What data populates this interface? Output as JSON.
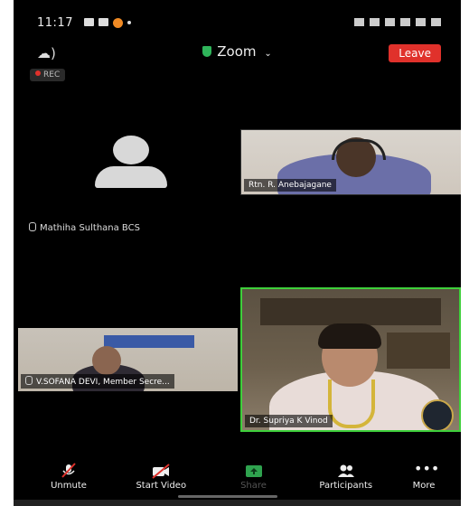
{
  "status_bar": {
    "time": "11:17"
  },
  "header": {
    "meeting_title": "Zoom",
    "leave_label": "Leave",
    "rec_label": "REC"
  },
  "participants": [
    {
      "name": "Rtn. R. Anebajagane"
    },
    {
      "name": "Mathiha Sulthana BCS"
    },
    {
      "name": "V.SOFANA DEVI, Member Secre..."
    },
    {
      "name": "Dr. Supriya K Vinod"
    }
  ],
  "toolbar": {
    "unmute": "Unmute",
    "start_video": "Start Video",
    "share": "Share",
    "participants": "Participants",
    "more": "More"
  },
  "colors": {
    "leave_button": "#e0312b",
    "active_speaker_border": "#3ecf3b",
    "shield": "#2fb45a",
    "share_icon": "#2fa34f"
  }
}
